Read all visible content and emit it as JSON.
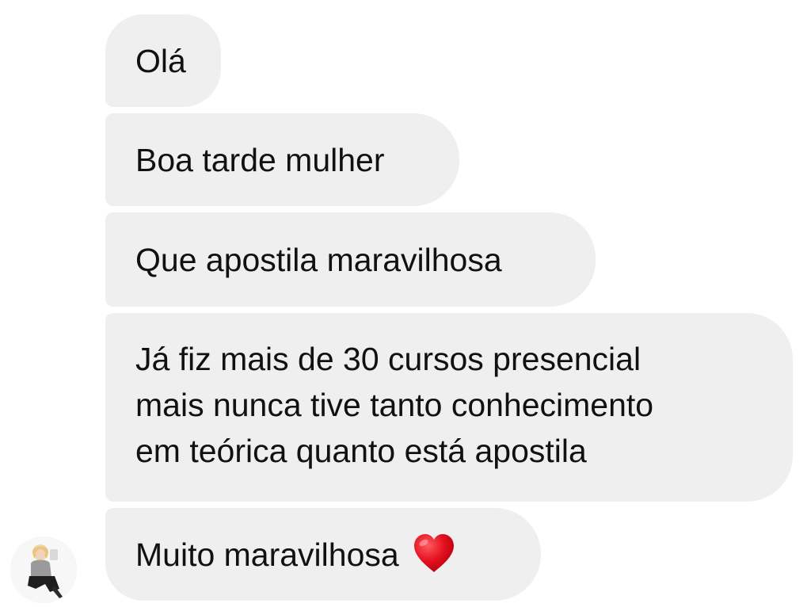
{
  "messages": [
    {
      "lines": [
        "Olá"
      ]
    },
    {
      "lines": [
        "Boa tarde mulher"
      ]
    },
    {
      "lines": [
        "Que apostila maravilhosa"
      ]
    },
    {
      "lines": [
        "Já fiz mais de 30 cursos presencial",
        "mais nunca tive tanto conhecimento",
        "em teórica quanto está apostila"
      ]
    },
    {
      "lines": [
        "Muito maravilhosa"
      ],
      "emoji": "heart-icon"
    }
  ],
  "colors": {
    "bubble_bg": "#efefef",
    "text": "#111111",
    "heart": "#e3101f"
  },
  "avatar": {
    "icon": "profile-photo"
  }
}
